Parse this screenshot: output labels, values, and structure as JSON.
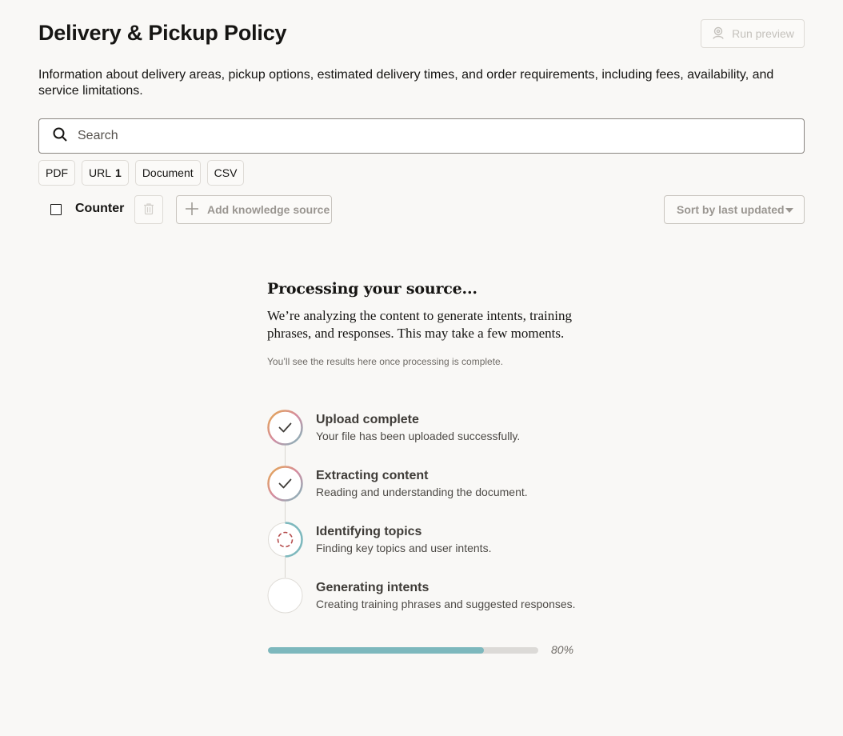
{
  "page": {
    "title": "Delivery & Pickup Policy",
    "description": "Information about delivery areas, pickup options, estimated delivery times, and order requirements, including fees, availability, and service limitations."
  },
  "header": {
    "run_preview_label": "Run preview",
    "run_preview_icon": "user-preview-icon"
  },
  "search": {
    "placeholder": "Search",
    "value": "",
    "icon": "search-icon"
  },
  "filters": [
    {
      "label": "PDF",
      "count": ""
    },
    {
      "label": "URL",
      "count": "1"
    },
    {
      "label": "Document",
      "count": ""
    },
    {
      "label": "CSV",
      "count": ""
    }
  ],
  "toolbar": {
    "select_all_checked": false,
    "counter_label": "Counter",
    "delete_icon": "trash-icon",
    "add_label": "Add knowledge source",
    "add_icon": "plus-icon",
    "sort_label": "Sort by last updated",
    "sort_icon": "caret-down-icon"
  },
  "processing": {
    "title": "Processing your source...",
    "subtitle": "We’re analyzing the content to generate intents, training phrases, and responses. This may take a few moments.",
    "note": "You’ll see the results here once processing is complete.",
    "steps": [
      {
        "title": "Upload complete",
        "description": "Your file has been uploaded successfully.",
        "status": "done"
      },
      {
        "title": "Extracting content",
        "description": "Reading and understanding the document.",
        "status": "done"
      },
      {
        "title": "Identifying topics",
        "description": "Finding key topics and user intents.",
        "status": "active"
      },
      {
        "title": "Generating intents",
        "description": "Creating training phrases and suggested responses.",
        "status": "pending"
      }
    ],
    "progress": 80,
    "progress_label": "80%"
  },
  "colors": {
    "accent_teal": "#7db8bd",
    "accent_orange": "#e5a94f",
    "accent_pink": "#d58aa0",
    "spinner_red": "#b44a4a"
  }
}
